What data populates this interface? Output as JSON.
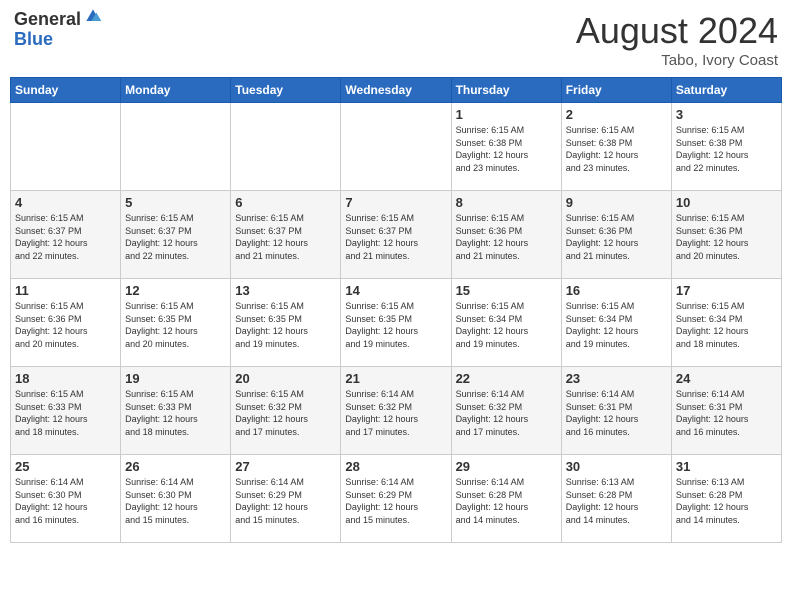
{
  "logo": {
    "general": "General",
    "blue": "Blue"
  },
  "title": {
    "month_year": "August 2024",
    "location": "Tabo, Ivory Coast"
  },
  "headers": [
    "Sunday",
    "Monday",
    "Tuesday",
    "Wednesday",
    "Thursday",
    "Friday",
    "Saturday"
  ],
  "weeks": [
    [
      {
        "day": "",
        "info": ""
      },
      {
        "day": "",
        "info": ""
      },
      {
        "day": "",
        "info": ""
      },
      {
        "day": "",
        "info": ""
      },
      {
        "day": "1",
        "info": "Sunrise: 6:15 AM\nSunset: 6:38 PM\nDaylight: 12 hours\nand 23 minutes."
      },
      {
        "day": "2",
        "info": "Sunrise: 6:15 AM\nSunset: 6:38 PM\nDaylight: 12 hours\nand 23 minutes."
      },
      {
        "day": "3",
        "info": "Sunrise: 6:15 AM\nSunset: 6:38 PM\nDaylight: 12 hours\nand 22 minutes."
      }
    ],
    [
      {
        "day": "4",
        "info": "Sunrise: 6:15 AM\nSunset: 6:37 PM\nDaylight: 12 hours\nand 22 minutes."
      },
      {
        "day": "5",
        "info": "Sunrise: 6:15 AM\nSunset: 6:37 PM\nDaylight: 12 hours\nand 22 minutes."
      },
      {
        "day": "6",
        "info": "Sunrise: 6:15 AM\nSunset: 6:37 PM\nDaylight: 12 hours\nand 21 minutes."
      },
      {
        "day": "7",
        "info": "Sunrise: 6:15 AM\nSunset: 6:37 PM\nDaylight: 12 hours\nand 21 minutes."
      },
      {
        "day": "8",
        "info": "Sunrise: 6:15 AM\nSunset: 6:36 PM\nDaylight: 12 hours\nand 21 minutes."
      },
      {
        "day": "9",
        "info": "Sunrise: 6:15 AM\nSunset: 6:36 PM\nDaylight: 12 hours\nand 21 minutes."
      },
      {
        "day": "10",
        "info": "Sunrise: 6:15 AM\nSunset: 6:36 PM\nDaylight: 12 hours\nand 20 minutes."
      }
    ],
    [
      {
        "day": "11",
        "info": "Sunrise: 6:15 AM\nSunset: 6:36 PM\nDaylight: 12 hours\nand 20 minutes."
      },
      {
        "day": "12",
        "info": "Sunrise: 6:15 AM\nSunset: 6:35 PM\nDaylight: 12 hours\nand 20 minutes."
      },
      {
        "day": "13",
        "info": "Sunrise: 6:15 AM\nSunset: 6:35 PM\nDaylight: 12 hours\nand 19 minutes."
      },
      {
        "day": "14",
        "info": "Sunrise: 6:15 AM\nSunset: 6:35 PM\nDaylight: 12 hours\nand 19 minutes."
      },
      {
        "day": "15",
        "info": "Sunrise: 6:15 AM\nSunset: 6:34 PM\nDaylight: 12 hours\nand 19 minutes."
      },
      {
        "day": "16",
        "info": "Sunrise: 6:15 AM\nSunset: 6:34 PM\nDaylight: 12 hours\nand 19 minutes."
      },
      {
        "day": "17",
        "info": "Sunrise: 6:15 AM\nSunset: 6:34 PM\nDaylight: 12 hours\nand 18 minutes."
      }
    ],
    [
      {
        "day": "18",
        "info": "Sunrise: 6:15 AM\nSunset: 6:33 PM\nDaylight: 12 hours\nand 18 minutes."
      },
      {
        "day": "19",
        "info": "Sunrise: 6:15 AM\nSunset: 6:33 PM\nDaylight: 12 hours\nand 18 minutes."
      },
      {
        "day": "20",
        "info": "Sunrise: 6:15 AM\nSunset: 6:32 PM\nDaylight: 12 hours\nand 17 minutes."
      },
      {
        "day": "21",
        "info": "Sunrise: 6:14 AM\nSunset: 6:32 PM\nDaylight: 12 hours\nand 17 minutes."
      },
      {
        "day": "22",
        "info": "Sunrise: 6:14 AM\nSunset: 6:32 PM\nDaylight: 12 hours\nand 17 minutes."
      },
      {
        "day": "23",
        "info": "Sunrise: 6:14 AM\nSunset: 6:31 PM\nDaylight: 12 hours\nand 16 minutes."
      },
      {
        "day": "24",
        "info": "Sunrise: 6:14 AM\nSunset: 6:31 PM\nDaylight: 12 hours\nand 16 minutes."
      }
    ],
    [
      {
        "day": "25",
        "info": "Sunrise: 6:14 AM\nSunset: 6:30 PM\nDaylight: 12 hours\nand 16 minutes."
      },
      {
        "day": "26",
        "info": "Sunrise: 6:14 AM\nSunset: 6:30 PM\nDaylight: 12 hours\nand 15 minutes."
      },
      {
        "day": "27",
        "info": "Sunrise: 6:14 AM\nSunset: 6:29 PM\nDaylight: 12 hours\nand 15 minutes."
      },
      {
        "day": "28",
        "info": "Sunrise: 6:14 AM\nSunset: 6:29 PM\nDaylight: 12 hours\nand 15 minutes."
      },
      {
        "day": "29",
        "info": "Sunrise: 6:14 AM\nSunset: 6:28 PM\nDaylight: 12 hours\nand 14 minutes."
      },
      {
        "day": "30",
        "info": "Sunrise: 6:13 AM\nSunset: 6:28 PM\nDaylight: 12 hours\nand 14 minutes."
      },
      {
        "day": "31",
        "info": "Sunrise: 6:13 AM\nSunset: 6:28 PM\nDaylight: 12 hours\nand 14 minutes."
      }
    ]
  ]
}
